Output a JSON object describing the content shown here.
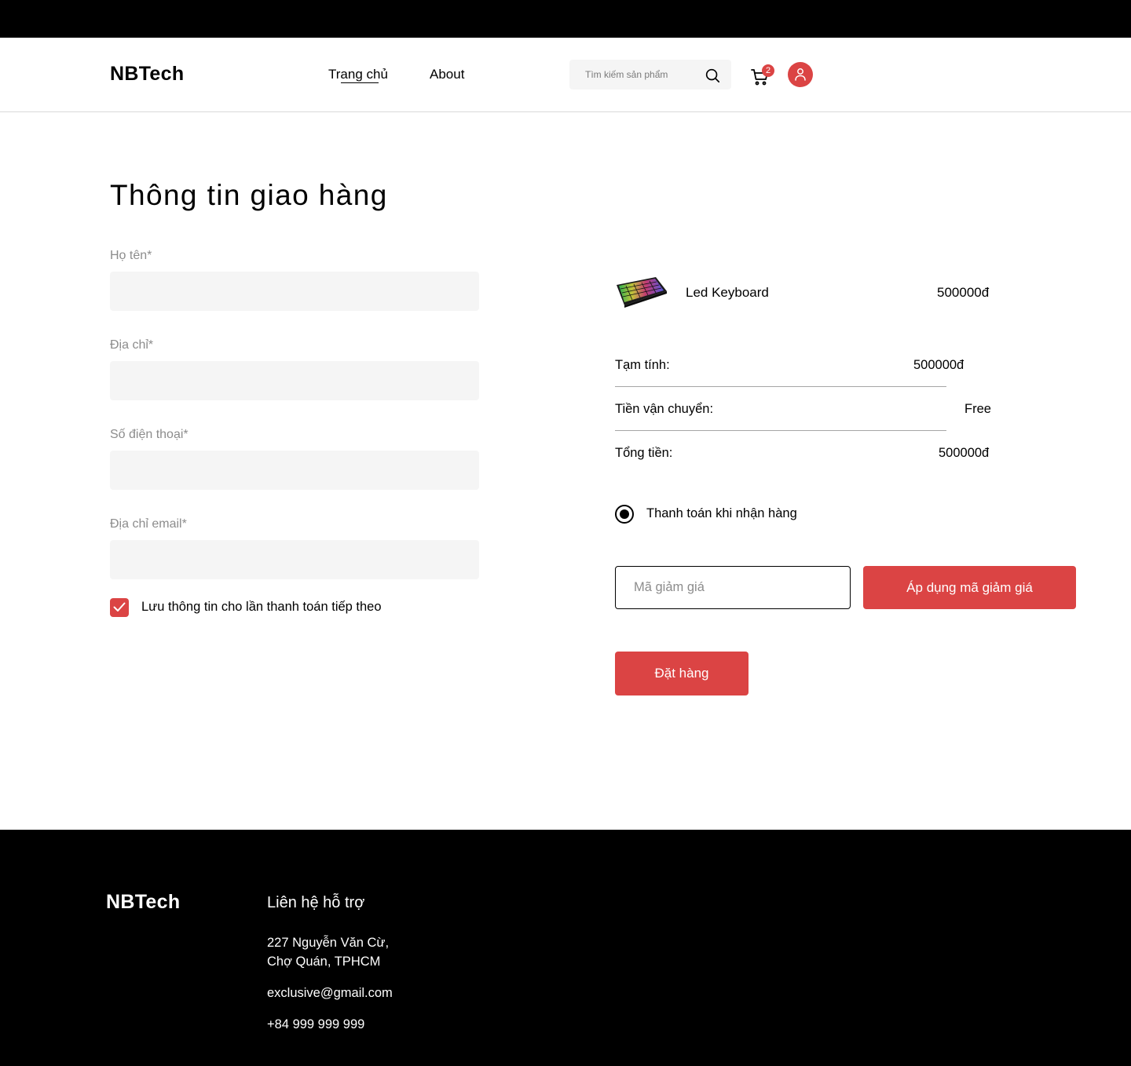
{
  "header": {
    "logo": "NBTech",
    "nav": {
      "home": "Trang chủ",
      "about": "About"
    },
    "search": {
      "placeholder": "Tìm kiếm sản phẩm"
    },
    "cart_count": "2"
  },
  "checkout": {
    "title": "Thông tin giao hàng",
    "fields": {
      "name_label": "Họ tên*",
      "address_label": "Địa chỉ*",
      "phone_label": "Số điện thoại*",
      "email_label": "Địa chỉ email*"
    },
    "save_info": {
      "label": "Lưu thông tin cho lần thanh toán tiếp theo",
      "checked": true
    }
  },
  "order": {
    "item": {
      "name": "Led Keyboard",
      "price": "500000đ"
    },
    "summary": {
      "subtotal_label": "Tạm tính:",
      "subtotal_value": "500000đ",
      "shipping_label": "Tiền vận chuyển:",
      "shipping_value": "Free",
      "total_label": "Tổng tiền:",
      "total_value": "500000đ"
    },
    "payment": {
      "label": "Thanh toán khi nhận hàng",
      "selected": true
    },
    "coupon": {
      "placeholder": "Mã giảm giá",
      "apply_label": "Áp dụng mã giảm giá"
    },
    "place_order_label": "Đặt hàng"
  },
  "footer": {
    "logo": "NBTech",
    "support_heading": "Liên hệ hỗ trợ",
    "address_line1": "227 Nguyễn Văn Cừ,",
    "address_line2": "Chợ Quán, TPHCM",
    "email": "exclusive@gmail.com",
    "phone": "+84 999 999 999"
  },
  "colors": {
    "accent": "#db4444",
    "input_bg": "#f5f5f5",
    "footer_bg": "#000000",
    "muted_text": "#8c8c8c"
  },
  "icons": {
    "search": "search-icon",
    "cart": "cart-icon",
    "user": "user-icon",
    "check": "check-icon"
  }
}
